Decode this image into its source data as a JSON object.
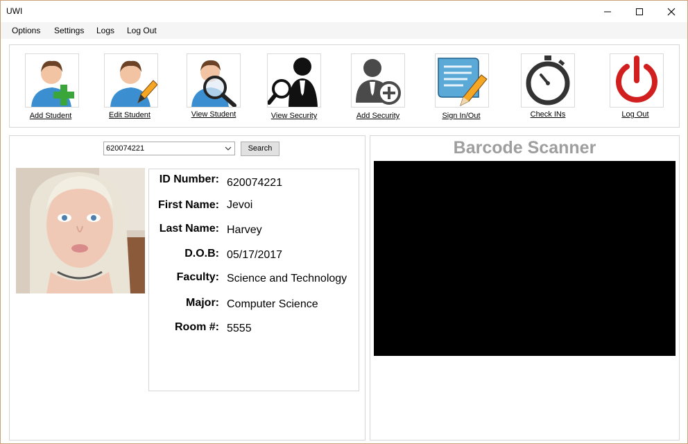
{
  "window": {
    "title": "UWI"
  },
  "menu": [
    "Options",
    "Settings",
    "Logs",
    "Log Out"
  ],
  "toolbar": [
    {
      "label": "Add Student",
      "icon": "add-student-icon"
    },
    {
      "label": "Edit Student",
      "icon": "edit-student-icon"
    },
    {
      "label": "View Student",
      "icon": "view-student-icon"
    },
    {
      "label": "View Security",
      "icon": "view-security-icon"
    },
    {
      "label": "Add Security",
      "icon": "add-security-icon"
    },
    {
      "label": "Sign In/Out",
      "icon": "sign-in-out-icon"
    },
    {
      "label": "Check INs",
      "icon": "stopwatch-icon"
    },
    {
      "label": "Log Out",
      "icon": "power-icon"
    }
  ],
  "search": {
    "value": "620074221",
    "button": "Search"
  },
  "student": {
    "fields": [
      {
        "label": "ID Number:",
        "value": "620074221"
      },
      {
        "label": "First Name:",
        "value": "Jevoi"
      },
      {
        "label": "Last Name:",
        "value": "Harvey"
      },
      {
        "label": "D.O.B:",
        "value": "05/17/2017"
      },
      {
        "label": "Faculty:",
        "value": "Science and Technology"
      },
      {
        "label": "Major:",
        "value": "Computer Science"
      },
      {
        "label": "Room #:",
        "value": "5555"
      }
    ]
  },
  "scanner": {
    "title": "Barcode Scanner"
  },
  "colors": {
    "accent_green": "#3aa63a",
    "power_red": "#d11f1f",
    "scanner_title": "#9e9e9e"
  }
}
